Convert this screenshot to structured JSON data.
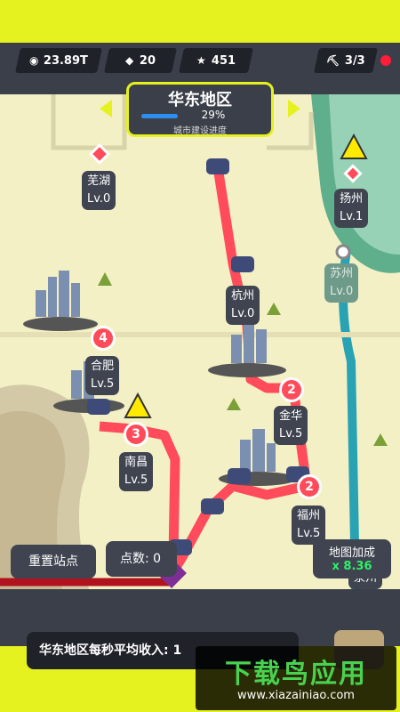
{
  "hud": {
    "coins": "23.89T",
    "gems": "20",
    "stars": "451",
    "workers": "3/3",
    "icons": {
      "coins": "coin-icon",
      "gems": "gem-icon",
      "stars": "star-icon",
      "workers": "pickaxe-icon"
    }
  },
  "region": {
    "title": "华东地区",
    "progress_percent": 29,
    "progress_text": "29%",
    "subtitle": "城市建设进度"
  },
  "cities": [
    {
      "name": "芜湖",
      "level": "Lv.0"
    },
    {
      "name": "扬州",
      "level": "Lv.1"
    },
    {
      "name": "苏州",
      "level": "Lv.0"
    },
    {
      "name": "杭州",
      "level": "Lv.0"
    },
    {
      "name": "合肥",
      "level": "Lv.5"
    },
    {
      "name": "南昌",
      "level": "Lv.5"
    },
    {
      "name": "金华",
      "level": "Lv.5"
    },
    {
      "name": "福州",
      "level": "Lv.5"
    },
    {
      "name": "泉州",
      "level": ""
    }
  ],
  "badges": [
    "4",
    "3",
    "2",
    "2"
  ],
  "buttons": {
    "reset": "重置站点",
    "points_label": "点数:",
    "points_value": "0"
  },
  "bonus": {
    "label": "地图加成",
    "value": "x 8.36"
  },
  "income": {
    "label": "华东地区每秒平均收入: 1"
  },
  "watermark": {
    "title": "下载鸟应用",
    "url": "www.xiazainiao.com"
  },
  "colors": {
    "accent": "#e6f21f",
    "route": "#ff4b5a",
    "panel": "#3a3f49",
    "bonus_value": "#2ef06a"
  }
}
